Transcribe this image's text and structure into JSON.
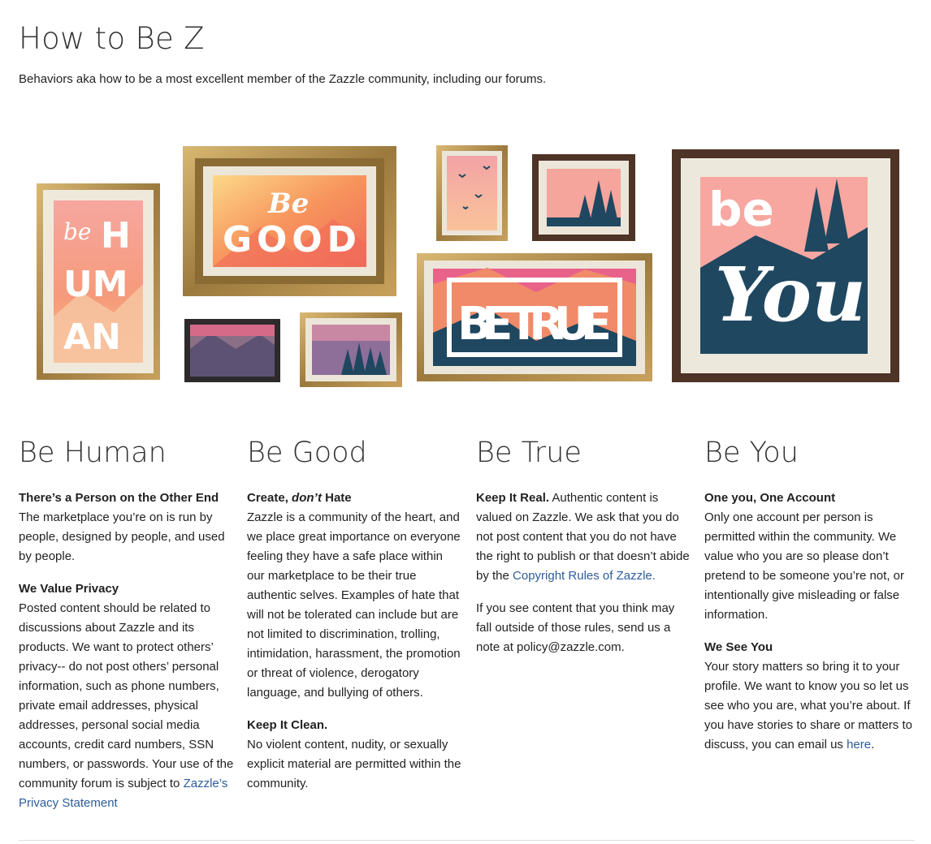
{
  "page": {
    "title": "How to Be Z",
    "subtitle": "Behaviors aka how to be a most excellent member of the Zazzle community, including our forums."
  },
  "hero": {
    "frame_be_human": {
      "word1": "be",
      "word2": "HUMAN",
      "lines": [
        "H",
        "UM",
        "AN"
      ]
    },
    "frame_be_good": {
      "word1": "Be",
      "word2": "GOOD"
    },
    "frame_be_true": {
      "text": "BE TRUE"
    },
    "frame_be_you": {
      "word1": "be",
      "word2": "You"
    },
    "colors": {
      "coral": "#f47e6a",
      "peach": "#f9b48c",
      "navy": "#1f4760",
      "gold": "#b5924f",
      "brown": "#4e3327"
    }
  },
  "columns": [
    {
      "heading": "Be Human",
      "sections": [
        {
          "title": "There’s a Person on the Other End",
          "body": "The marketplace you’re on is run by people, designed by people, and used by people."
        },
        {
          "title": "We Value Privacy",
          "body": "Posted content should be related to discussions about Zazzle and its products. We want to protect others’ privacy-- do not post others’ personal information, such as phone numbers, private email addresses, physical addresses, personal social media accounts, credit card numbers, SSN numbers, or passwords. Your use of the community forum is subject to",
          "link": "Zazzle’s Privacy Statement"
        }
      ]
    },
    {
      "heading": "Be Good",
      "sections": [
        {
          "title_pre": "Create, ",
          "title_em": "don’t",
          "title_post": " Hate",
          "body": "Zazzle is a community of the heart, and we place great importance on everyone feeling they have a safe place within our marketplace to be their true authentic selves. Examples of hate that will not be tolerated can include but are not limited to discrimination, trolling, intimidation, harassment, the promotion or threat of violence, derogatory language, and bullying of others."
        },
        {
          "title": "Keep It Clean.",
          "body": "No violent content, nudity, or sexually explicit material are permitted within the community."
        }
      ]
    },
    {
      "heading": "Be True",
      "sections": [
        {
          "lead": "Keep It Real.",
          "body": " Authentic content is valued on Zazzle. We ask that you do not post content that you do not have the right to publish or that doesn’t abide by the ",
          "link": "Copyright Rules of Zazzle."
        },
        {
          "body": "If you see content that you think may fall outside of those rules, send us a note at policy@zazzle.com."
        }
      ]
    },
    {
      "heading": "Be You",
      "sections": [
        {
          "title": "One you, One Account",
          "body": "Only one account per person is permitted within the community. We value who you are so please don’t pretend to be someone you’re not, or intentionally give misleading or false information."
        },
        {
          "title": "We See You",
          "body": "Your story matters so bring it to your profile. We want to know you so let us see who you are, what you’re about. If you have stories to share or matters to discuss, you can email us ",
          "link": "here",
          "after": "."
        }
      ]
    }
  ]
}
